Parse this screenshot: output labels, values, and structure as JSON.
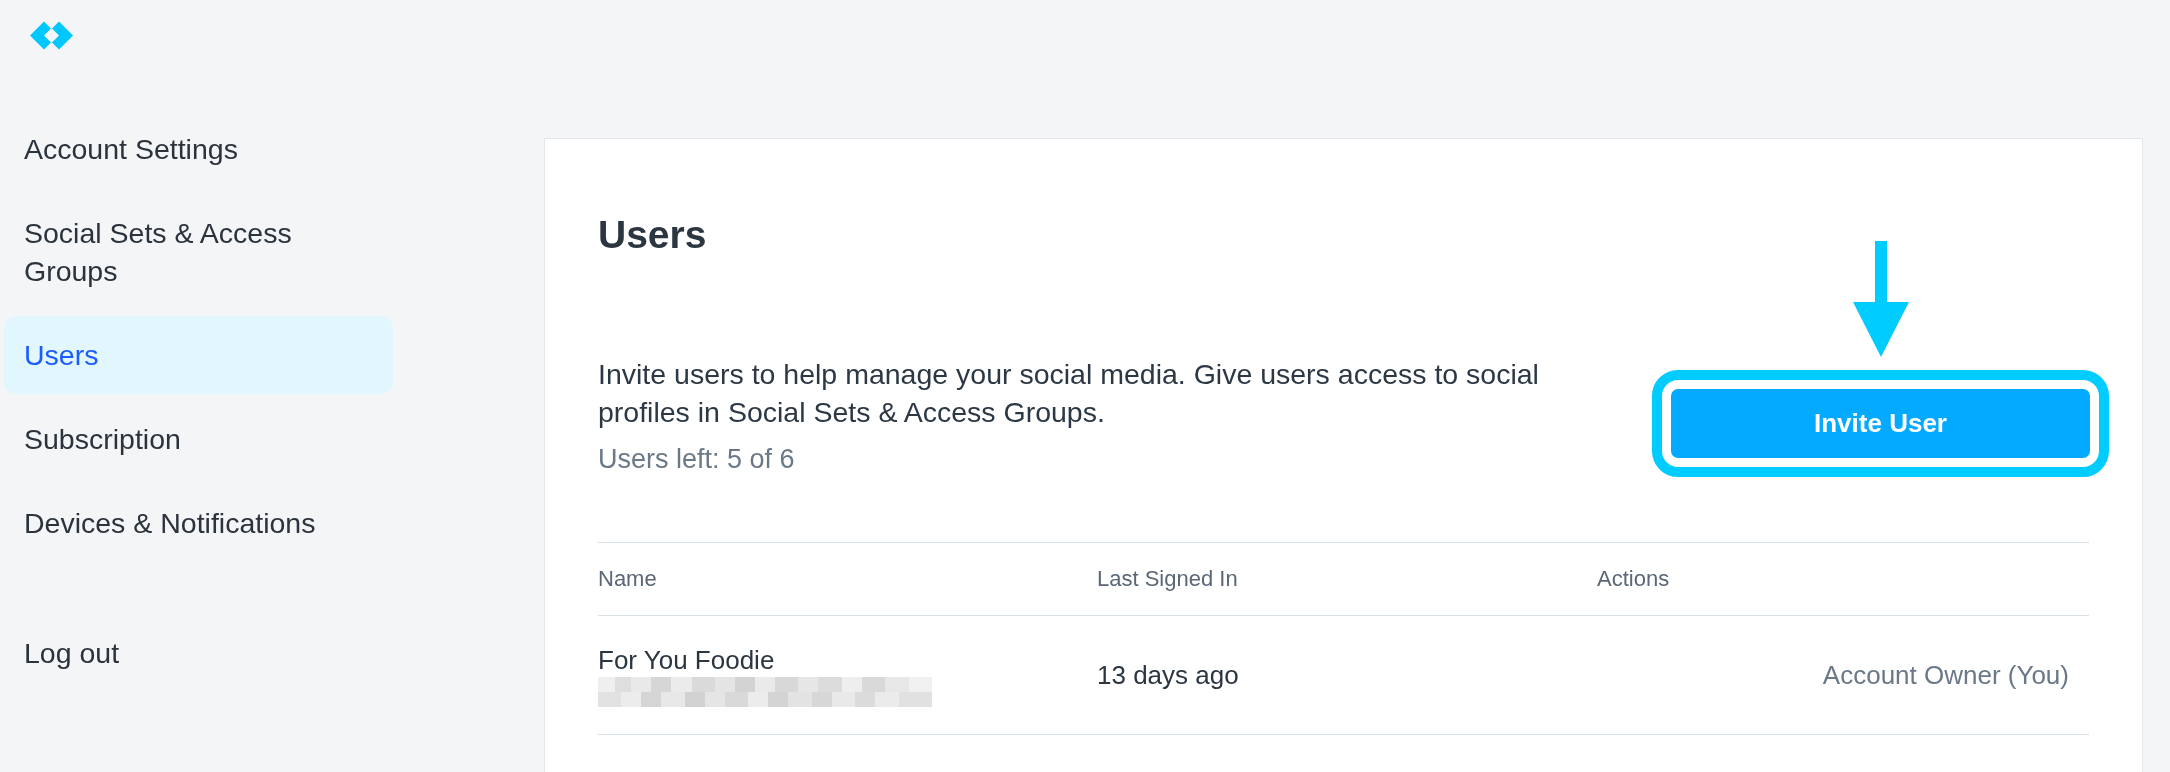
{
  "sidebar": {
    "items": [
      {
        "label": "Account Settings",
        "selected": false
      },
      {
        "label": "Social Sets & Access Groups",
        "selected": false
      },
      {
        "label": "Users",
        "selected": true
      },
      {
        "label": "Subscription",
        "selected": false
      },
      {
        "label": "Devices & Notifications",
        "selected": false
      }
    ],
    "logout": {
      "label": "Log out"
    }
  },
  "page": {
    "title": "Users",
    "description": "Invite users to help manage your social media. Give users access to social profiles in Social Sets & Access Groups.",
    "users_left": "Users left: 5 of 6",
    "invite_button": {
      "label": "Invite User",
      "highlighted": true
    }
  },
  "table": {
    "columns": [
      "Name",
      "Last Signed In",
      "Actions"
    ],
    "rows": [
      {
        "name": "For You Foodie",
        "email_blurred": true,
        "last_signed_in": "13 days ago",
        "action": "Account Owner (You)"
      }
    ]
  }
}
